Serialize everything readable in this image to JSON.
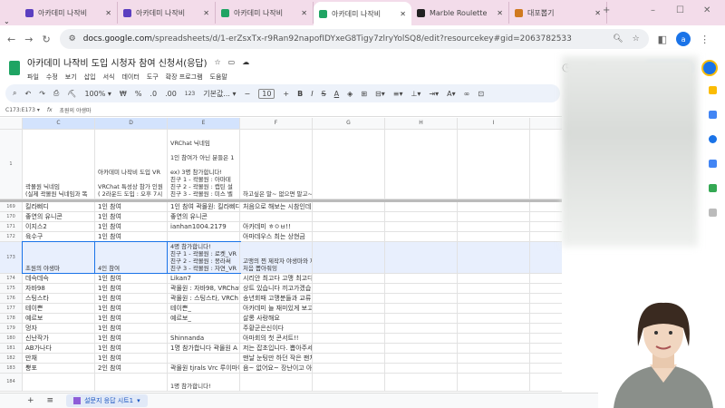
{
  "browser": {
    "tabs": [
      {
        "label": "아카데미 나작비",
        "color": "#5b3fc0",
        "active": false
      },
      {
        "label": "아카데미 나작비",
        "color": "#5b3fc0",
        "active": false
      },
      {
        "label": "아카데미 나작비",
        "color": "#1fa463",
        "active": false
      },
      {
        "label": "아카데미 나작비",
        "color": "#1fa463",
        "active": true
      },
      {
        "label": "Marble Roulette",
        "color": "#222",
        "active": false
      },
      {
        "label": "대포뽑기",
        "color": "#d07a20",
        "active": false
      }
    ],
    "url_host": "docs.google.com",
    "url_path": "/spreadsheets/d/1-erZsxTx-r9Ran92napofIDYxeG8Tigy7zlryYolSQ8/edit?resourcekey#gid=2063782533",
    "profile_initial": "a"
  },
  "doc": {
    "title": "아카데미 나작비 도입 시청자 참여 신청서(응답)",
    "menu": [
      "파일",
      "수정",
      "보기",
      "삽입",
      "서식",
      "데이터",
      "도구",
      "확장 프로그램",
      "도움말"
    ],
    "toolbar": {
      "zoom": "100%",
      "font": "기본값...",
      "font_size": "10",
      "format_123": "123"
    },
    "cell_ref": "C173:E173",
    "formula": "초원의 야생마"
  },
  "grid": {
    "columns": [
      "C",
      "D",
      "E",
      "F",
      "G",
      "H",
      "I"
    ],
    "header_row": {
      "num": "1",
      "c": "곽몰원 닉네임\n(실제 곽몰원 닉네임과 똑",
      "d": "아카데미 나작비 도입 VR\n\nVRChat 특성상 참가 인원\n( 2라운드 도입 : 오후 7시",
      "e": "VRChat 닉네임\n\n1인 참여가 아닌 분들은 1\n\nex) 3명 참가합니다!\n친구 1 - 곽몰원 : 아마데\n친구 2 - 곽몰원 : 캡틴 설\n친구 3 - 곽몰원 : 미스 벨",
      "f": "하고싶은 말~ 없으면 말고~"
    },
    "rows": [
      {
        "num": "169",
        "c": "킬라삐디",
        "d": "1인 참여",
        "e": "1인 참여 곽몰원: 킬라삐디",
        "f": "처음으로 해보는 시참인데 꼭 당첨될 수 있기를 )"
      },
      {
        "num": "170",
        "c": "좋연의 유니콘",
        "d": "1인 참여",
        "e": "좋연의 유니콘",
        "f": ""
      },
      {
        "num": "171",
        "c": "이지스2",
        "d": "1인 참여",
        "e": "ianhan1004.2179",
        "f": "아카데미 ㅎㅇㅂ!!"
      },
      {
        "num": "172",
        "c": "육수구",
        "d": "1인 참여",
        "e": "",
        "f": "아마데우스 최는 상현금"
      },
      {
        "num": "173",
        "c": "초원의 야생마",
        "d": "4인 참여",
        "e": "4명 참가합니다!\n친구 1 - 곽몰원 : 로켓_VR\n친구 2 - 곽몰원 : 몽라써\n친구 3 - 곽몰원 : 자연_VR",
        "f": "고맹의 찐 제작자 야생마와 제자(망아지) 들입니다\n처음 뽑아줘잉"
      },
      {
        "num": "174",
        "c": "데슥데슥",
        "d": "1인 참여",
        "e": "Likan7",
        "f": "시리안 최고다 고맹 최고다"
      },
      {
        "num": "175",
        "c": "자바98",
        "d": "1인 참여",
        "e": "곽몰원 : 자바98, VRChat",
        "f": "상트 있습니다 끼고가겠습니다 아마회님 아카데미 모두 사랑합니다"
      },
      {
        "num": "176",
        "c": "스팅스타",
        "d": "1인 참여",
        "e": "곽몰원 : 스팅스타, VRCh",
        "f": "송년회때 고맹분들과 교류 많이 못한 한을 풀때가 왔습니다 잘부탁드립니다"
      },
      {
        "num": "177",
        "c": "테이쁜",
        "d": "1인 참여",
        "e": "테이쁜_",
        "f": "아카데미 늘 재미있게 보고있습니다 이번에 승리하길 바랍니다 화이팅! 전향 빅토리 화이팅!"
      },
      {
        "num": "178",
        "c": "예르보",
        "d": "1인 참여",
        "e": "예르보_",
        "f": "살롱 사랑해요"
      },
      {
        "num": "179",
        "c": "멍자",
        "d": "1인 참여",
        "e": "",
        "f": "주황군은신이다"
      },
      {
        "num": "180",
        "c": "신난작가",
        "d": "1인 참여",
        "e": "Shinnanda",
        "f": "아마회의 첫 콘서트!!"
      },
      {
        "num": "181",
        "c": "AB가나다",
        "d": "1인 참여",
        "e": "1명 참가합니다 곽몰원 A",
        "f": "저는 잡초입니다. 뽑아주세요!!"
      },
      {
        "num": "182",
        "c": "만채",
        "d": "1인 참여",
        "e": "",
        "f": "맨날 눈팅만 하던 작은 팬치입니다. 나작비 컨텐츠에 꼭 한 번 참여해보고 싶어 신청했습니다!!!"
      },
      {
        "num": "183",
        "c": "뿡포",
        "d": "2인 참여",
        "e": "곽몰원 tjrals Vrc 루이마이",
        "f": "음~ 없어요~  장난이고 아마회님 사랑합니다~"
      },
      {
        "num": "184",
        "c": "",
        "d": "",
        "e": "1명 참가합니다!",
        "f": ""
      }
    ]
  },
  "sheet_tab": "설문지 응답 시트1"
}
